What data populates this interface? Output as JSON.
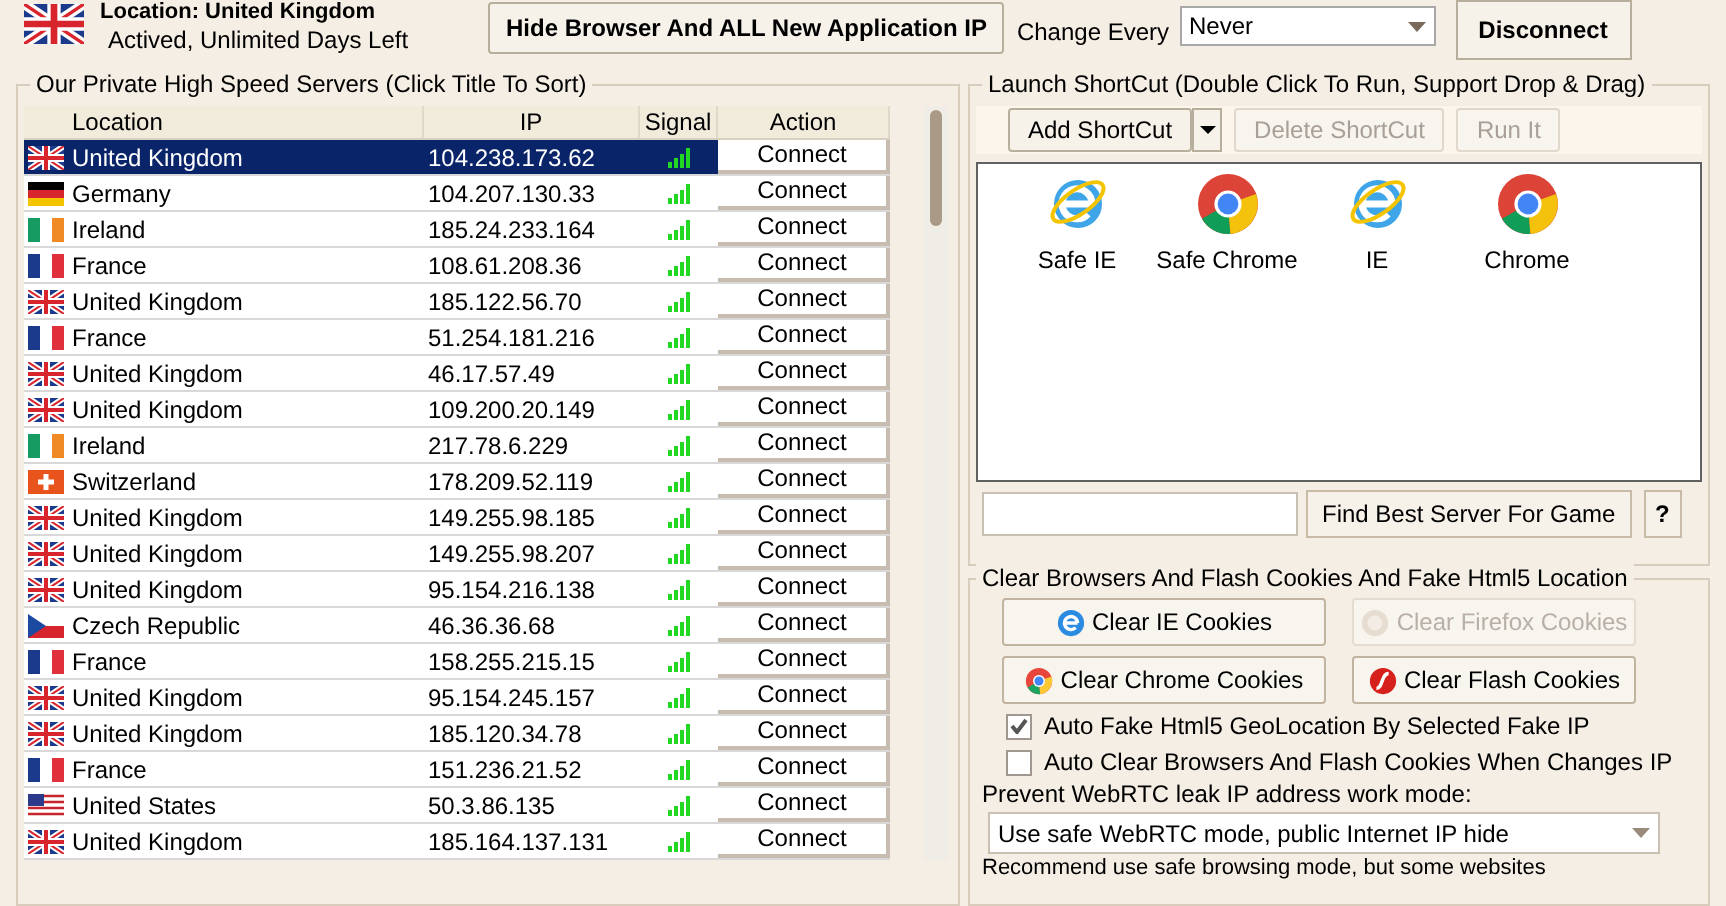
{
  "status": {
    "location": "Location: United Kingdom",
    "kind": "uk",
    "subscription": "Actived, Unlimited Days Left"
  },
  "hide_button": "Hide Browser And ALL New Application IP",
  "change_every": {
    "label": "Change Every",
    "value": "Never"
  },
  "disconnect_button": "Disconnect",
  "servers": {
    "title": "Our Private High Speed Servers (Click Title To Sort)",
    "columns": [
      "Location",
      "IP",
      "Signal",
      "Action"
    ],
    "rows": [
      {
        "kind": "uk",
        "location": "United Kingdom",
        "ip": "104.238.173.62",
        "action": "Connect",
        "selected": true
      },
      {
        "kind": "de",
        "location": "Germany",
        "ip": "104.207.130.33",
        "action": "Connect",
        "selected": false
      },
      {
        "kind": "ie",
        "location": "Ireland",
        "ip": "185.24.233.164",
        "action": "Connect",
        "selected": false
      },
      {
        "kind": "fr",
        "location": "France",
        "ip": "108.61.208.36",
        "action": "Connect",
        "selected": false
      },
      {
        "kind": "uk",
        "location": "United Kingdom",
        "ip": "185.122.56.70",
        "action": "Connect",
        "selected": false
      },
      {
        "kind": "fr",
        "location": "France",
        "ip": "51.254.181.216",
        "action": "Connect",
        "selected": false
      },
      {
        "kind": "uk",
        "location": "United Kingdom",
        "ip": "46.17.57.49",
        "action": "Connect",
        "selected": false
      },
      {
        "kind": "uk",
        "location": "United Kingdom",
        "ip": "109.200.20.149",
        "action": "Connect",
        "selected": false
      },
      {
        "kind": "ie",
        "location": "Ireland",
        "ip": "217.78.6.229",
        "action": "Connect",
        "selected": false
      },
      {
        "kind": "ch",
        "location": "Switzerland",
        "ip": "178.209.52.119",
        "action": "Connect",
        "selected": false
      },
      {
        "kind": "uk",
        "location": "United Kingdom",
        "ip": "149.255.98.185",
        "action": "Connect",
        "selected": false
      },
      {
        "kind": "uk",
        "location": "United Kingdom",
        "ip": "149.255.98.207",
        "action": "Connect",
        "selected": false
      },
      {
        "kind": "uk",
        "location": "United Kingdom",
        "ip": "95.154.216.138",
        "action": "Connect",
        "selected": false
      },
      {
        "kind": "cz",
        "location": "Czech Republic",
        "ip": "46.36.36.68",
        "action": "Connect",
        "selected": false
      },
      {
        "kind": "fr",
        "location": "France",
        "ip": "158.255.215.15",
        "action": "Connect",
        "selected": false
      },
      {
        "kind": "uk",
        "location": "United Kingdom",
        "ip": "95.154.245.157",
        "action": "Connect",
        "selected": false
      },
      {
        "kind": "uk",
        "location": "United Kingdom",
        "ip": "185.120.34.78",
        "action": "Connect",
        "selected": false
      },
      {
        "kind": "fr",
        "location": "France",
        "ip": "151.236.21.52",
        "action": "Connect",
        "selected": false
      },
      {
        "kind": "us",
        "location": "United States",
        "ip": "50.3.86.135",
        "action": "Connect",
        "selected": false
      },
      {
        "kind": "uk",
        "location": "United Kingdom",
        "ip": "185.164.137.131",
        "action": "Connect",
        "selected": false
      }
    ]
  },
  "shortcuts": {
    "title": "Launch ShortCut (Double Click To Run, Support Drop & Drag)",
    "buttons": [
      {
        "label": "Add ShortCut",
        "disabled": false
      },
      {
        "label": "Delete ShortCut",
        "disabled": true
      },
      {
        "label": "Run It",
        "disabled": true
      }
    ],
    "items": [
      {
        "kind": "ie",
        "label": "Safe IE"
      },
      {
        "kind": "chrome",
        "label": "Safe Chrome"
      },
      {
        "kind": "ie",
        "label": "IE"
      },
      {
        "kind": "chrome",
        "label": "Chrome"
      }
    ],
    "find_button": "Find Best Server For Game",
    "help_button": "?"
  },
  "cookies": {
    "title": "Clear Browsers And Flash Cookies And Fake Html5 Location",
    "buttons": [
      {
        "kind": "ie",
        "label": "Clear IE Cookies",
        "disabled": false
      },
      {
        "kind": "firefox",
        "label": "Clear Firefox Cookies",
        "disabled": true
      },
      {
        "kind": "chrome",
        "label": "Clear Chrome Cookies",
        "disabled": false
      },
      {
        "kind": "flash",
        "label": "Clear Flash Cookies",
        "disabled": false
      }
    ],
    "options": [
      {
        "label": "Auto Fake Html5 GeoLocation By Selected Fake IP",
        "checked": true
      },
      {
        "label": "Auto Clear Browsers And Flash Cookies When Changes IP",
        "checked": false
      }
    ],
    "webrtc_label": "Prevent WebRTC leak IP address work mode:",
    "webrtc_mode": "Use safe WebRTC mode, public Internet IP hide",
    "note": "Recommend use safe browsing mode, but some websites"
  }
}
